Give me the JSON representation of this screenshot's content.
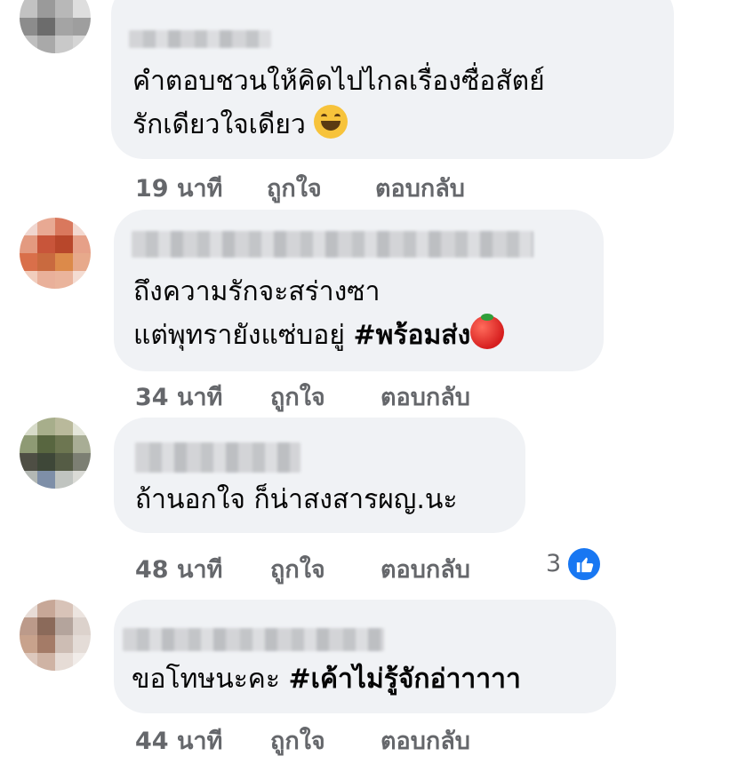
{
  "comments": [
    {
      "text_lines": [
        "คำตอบชวนให้คิดไปไกลเรื่องซื่อสัตย์",
        "รักเดียวใจเดียว"
      ],
      "emoji": "laughing-face-icon",
      "time": "19 นาที",
      "like_label": "ถูกใจ",
      "reply_label": "ตอบกลับ"
    },
    {
      "text_lines": [
        "ถึงความรักจะสร่างซา",
        "แต่พุทรายังแซ่บอยู่"
      ],
      "hashtag": "#พร้อมส่ง",
      "emoji": "tomato-icon",
      "time": "34 นาที",
      "like_label": "ถูกใจ",
      "reply_label": "ตอบกลับ"
    },
    {
      "text_lines": [
        "ถ้านอกใจ ก็น่าสงสารผญ.นะ"
      ],
      "time": "48 นาที",
      "like_label": "ถูกใจ",
      "reply_label": "ตอบกลับ",
      "reaction_count": "3",
      "reaction_icon": "like-thumb-icon"
    },
    {
      "text_prefix": "ขอโทษนะคะ",
      "hashtag": "#เค้าไม่รู้จักอ่าาาาา",
      "time": "44 นาที",
      "like_label": "ถูกใจ",
      "reply_label": "ตอบกลับ"
    }
  ],
  "colors": {
    "bubble": "#f0f2f5",
    "meta_text": "#65676b",
    "like_blue": "#1877f2"
  }
}
